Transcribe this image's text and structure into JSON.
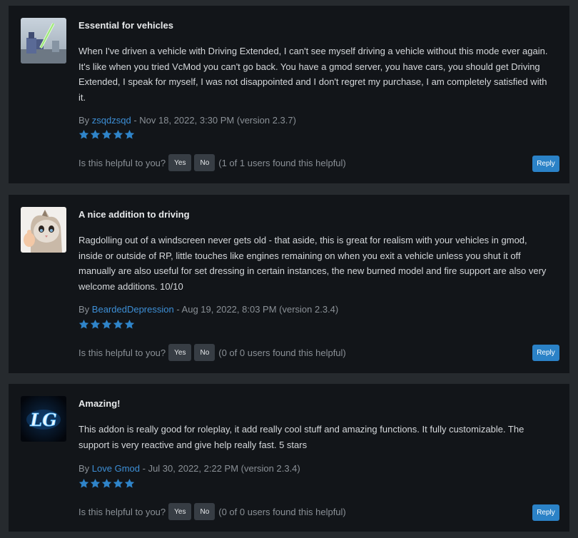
{
  "reviews": [
    {
      "title": "Essential for vehicles",
      "body": "When I've driven a vehicle with Driving Extended, I can't see myself driving a vehicle without this mode ever again. It's like when you tried VcMod you can't go back. You have a gmod server, you have cars, you should get Driving Extended, I speak for myself, I was not disappointed and I don't regret my purchase, I am completely satisfied with it.",
      "by_label": "By",
      "author": "zsqdzsqd",
      "meta": "- Nov 18, 2022, 3:30 PM (version 2.3.7)",
      "rating": 5,
      "helpful_question": "Is this helpful to you?",
      "yes_label": "Yes",
      "no_label": "No",
      "helpful_count": "(1 of 1 users found this helpful)",
      "reply_label": "Reply"
    },
    {
      "title": "A nice addition to driving",
      "body": "Ragdolling out of a windscreen never gets old - that aside, this is great for realism with your vehicles in gmod, inside or outside of RP, little touches like engines remaining on when you exit a vehicle unless you shut it off manually are also useful for set dressing in certain instances, the new burned model and fire support are also very welcome additions. 10/10",
      "by_label": "By",
      "author": "BeardedDepression",
      "meta": "- Aug 19, 2022, 8:03 PM (version 2.3.4)",
      "rating": 5,
      "helpful_question": "Is this helpful to you?",
      "yes_label": "Yes",
      "no_label": "No",
      "helpful_count": "(0 of 0 users found this helpful)",
      "reply_label": "Reply"
    },
    {
      "title": "Amazing!",
      "body": "This addon is really good for roleplay, it add really cool stuff and amazing functions. It fully customizable. The support is very reactive and give help really fast. 5 stars",
      "by_label": "By",
      "author": "Love Gmod",
      "meta": "- Jul 30, 2022, 2:22 PM (version 2.3.4)",
      "rating": 5,
      "helpful_question": "Is this helpful to you?",
      "yes_label": "Yes",
      "no_label": "No",
      "helpful_count": "(0 of 0 users found this helpful)",
      "reply_label": "Reply"
    }
  ],
  "avatar_text": {
    "lg_logo": "LG"
  },
  "icons": {
    "star": "star-icon"
  },
  "colors": {
    "page_bg": "#262a2e",
    "card_bg": "#121519",
    "accent": "#2b82c7",
    "link": "#3d8fd6",
    "star": "#2f84c9"
  }
}
